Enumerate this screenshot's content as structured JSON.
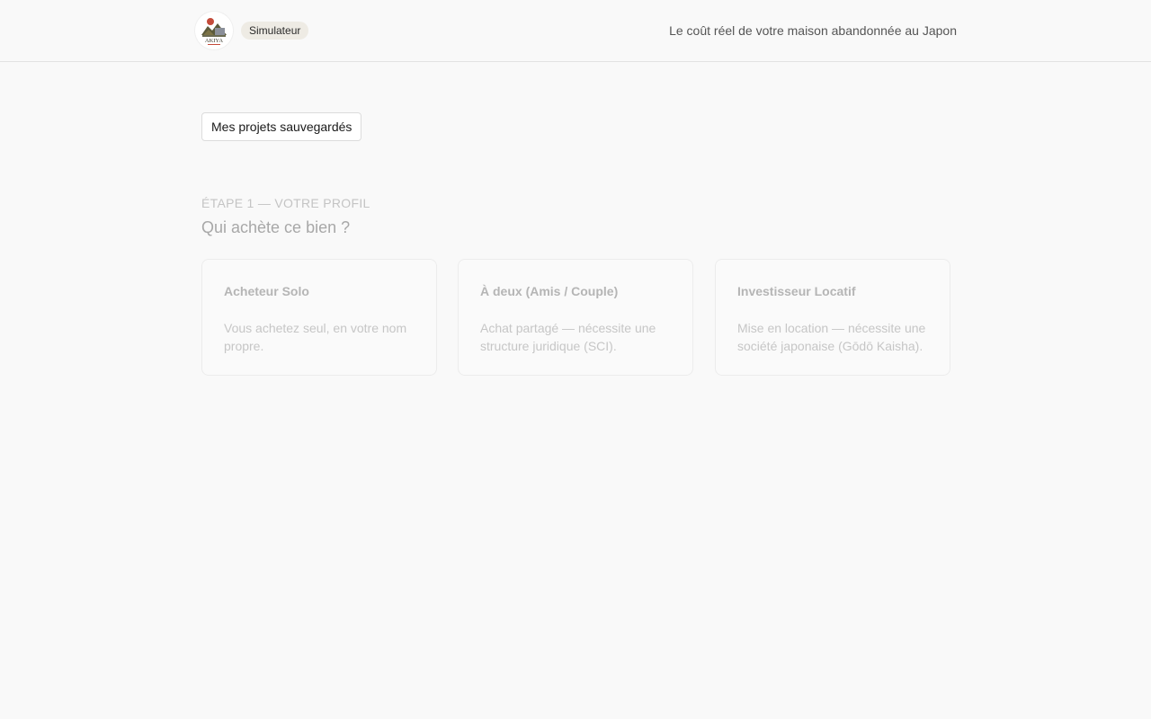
{
  "header": {
    "logo_text": "AKIYA",
    "badge": "Simulateur",
    "tagline": "Le coût réel de votre maison abandonnée au Japon"
  },
  "saved_projects_label": "Mes projets sauvegardés",
  "step": {
    "label": "ÉTAPE 1 — VOTRE PROFIL",
    "question": "Qui achète ce bien ?"
  },
  "profiles": [
    {
      "title": "Acheteur Solo",
      "description": "Vous achetez seul, en votre nom propre."
    },
    {
      "title": "À deux (Amis / Couple)",
      "description": "Achat partagé — nécessite une structure juridique (SCI)."
    },
    {
      "title": "Investisseur Locatif",
      "description": "Mise en location — nécessite une société japonaise (Gōdō Kaisha)."
    }
  ]
}
